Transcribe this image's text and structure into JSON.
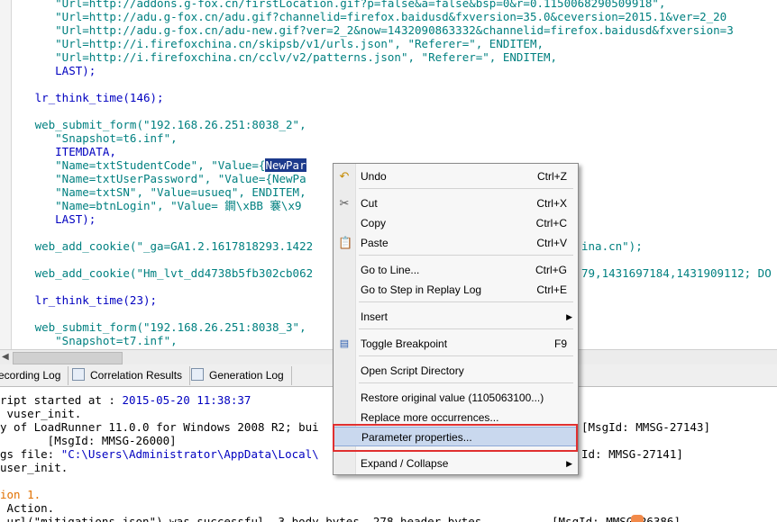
{
  "editor": {
    "lines": [
      {
        "kind": "raw",
        "text": "      \"Url=http://addons.g-fox.cn/firstLocation.gif?p=false&a=false&bsp=0&r=0.1150068290509918\","
      },
      {
        "kind": "raw",
        "text": "      \"Url=http://adu.g-fox.cn/adu.gif?channelid=firefox.baidusd&fxversion=35.0&ceversion=2015.1&ver=2_20"
      },
      {
        "kind": "raw",
        "text": "      \"Url=http://adu.g-fox.cn/adu-new.gif?ver=2_2&now=1432090863332&channelid=firefox.baidusd&fxversion=3"
      },
      {
        "kind": "raw",
        "text": "      \"Url=http://i.firefoxchina.cn/skipsb/v1/urls.json\", \"Referer=\", ENDITEM,"
      },
      {
        "kind": "raw",
        "text": "      \"Url=http://i.firefoxchina.cn/cclv/v2/patterns.json\", \"Referer=\", ENDITEM,"
      },
      {
        "kind": "raw",
        "text": "      LAST);"
      },
      {
        "kind": "raw",
        "text": ""
      },
      {
        "kind": "raw",
        "text": "   lr_think_time(146);"
      },
      {
        "kind": "raw",
        "text": ""
      },
      {
        "kind": "raw",
        "text": "   web_submit_form(\"192.168.26.251:8038_2\","
      },
      {
        "kind": "raw",
        "text": "      \"Snapshot=t6.inf\","
      },
      {
        "kind": "raw",
        "text": "      ITEMDATA,"
      },
      {
        "kind": "sel",
        "before": "      \"Name=txtStudentCode\", \"Value={",
        "selected": "NewPar",
        "after": ""
      },
      {
        "kind": "raw",
        "text": "      \"Name=txtUserPassword\", \"Value={NewPa"
      },
      {
        "kind": "raw",
        "text": "      \"Name=txtSN\", \"Value=usueq\", ENDITEM,"
      },
      {
        "kind": "raw",
        "text": "      \"Name=btnLogin\", \"Value= 鐧\\xBB 褰\\x9"
      },
      {
        "kind": "raw",
        "text": "      LAST);"
      },
      {
        "kind": "raw",
        "text": ""
      },
      {
        "kind": "raw",
        "text": "   web_add_cookie(\"_ga=GA1.2.1617818293.1422"
      },
      {
        "kind": "raw",
        "text": ""
      },
      {
        "kind": "raw",
        "text": "   web_add_cookie(\"Hm_lvt_dd4738b5fb302cb062"
      },
      {
        "kind": "raw",
        "text": ""
      },
      {
        "kind": "raw",
        "text": "   lr_think_time(23);"
      },
      {
        "kind": "raw",
        "text": ""
      },
      {
        "kind": "raw",
        "text": "   web_submit_form(\"192.168.26.251:8038_3\","
      },
      {
        "kind": "raw",
        "text": "      \"Snapshot=t7.inf\","
      }
    ],
    "right_fragments": {
      "line18": "ina.cn\");",
      "line20": "79,1431697184,1431909112; DO"
    }
  },
  "tabs": [
    {
      "label": "ecording Log",
      "icon": "log-icon"
    },
    {
      "label": "Correlation Results",
      "icon": "correlation-icon"
    },
    {
      "label": "Generation Log",
      "icon": "generation-log-icon"
    }
  ],
  "output": {
    "lines": [
      {
        "text": "ript started at : ",
        "highlight": "2015-05-20 11:38:37",
        "rest": ""
      },
      {
        "text": " vuser_init.",
        "highlight": "",
        "rest": ""
      },
      {
        "text": "y of LoadRunner 11.0.0 for Windows 2008 R2; bui",
        "highlight": "",
        "rest": ""
      },
      {
        "text": "       [MsgId: MMSG-26000]",
        "highlight": "",
        "rest": ""
      },
      {
        "text": "gs file: ",
        "highlight": "\"C:\\Users\\Administrator\\AppData\\Local\\",
        "rest": ""
      },
      {
        "text": "user_init.",
        "highlight": "",
        "rest": ""
      },
      {
        "text": "",
        "highlight": "",
        "rest": ""
      },
      {
        "text": "",
        "orange": "ion 1.",
        "rest": ""
      },
      {
        "text": " Action.",
        "highlight": "",
        "rest": ""
      },
      {
        "text": " url(\"mitigations.json\") was successful, 3 body bytes, 278 header bytes",
        "highlight": "",
        "rest": ""
      }
    ],
    "right_fragments": {
      "msg1": "[MsgId: MMSG-27143]",
      "msg2": "Id: MMSG-27141]",
      "msg3": "[MsgId: MMSG-26386]"
    }
  },
  "context_menu": {
    "items": [
      {
        "label": "Undo",
        "shortcut": "Ctrl+Z",
        "icon": "undo-icon"
      },
      {
        "label": "Cut",
        "shortcut": "Ctrl+X",
        "icon": "cut-icon"
      },
      {
        "label": "Copy",
        "shortcut": "Ctrl+C",
        "icon": ""
      },
      {
        "label": "Paste",
        "shortcut": "Ctrl+V",
        "icon": "paste-icon"
      },
      {
        "label": "Go to Line...",
        "shortcut": "Ctrl+G",
        "icon": ""
      },
      {
        "label": "Go to Step in Replay Log",
        "shortcut": "Ctrl+E",
        "icon": ""
      },
      {
        "label": "Insert",
        "shortcut": "",
        "icon": "",
        "submenu": "▶"
      },
      {
        "label": "Toggle Breakpoint",
        "shortcut": "F9",
        "icon": "breakpoint-icon"
      },
      {
        "label": "Open Script Directory",
        "shortcut": "",
        "icon": ""
      },
      {
        "label": "Restore original value (1105063100...)",
        "shortcut": "",
        "icon": ""
      },
      {
        "label": "Replace more occurrences...",
        "shortcut": "",
        "icon": ""
      },
      {
        "label": "Parameter properties...",
        "shortcut": "",
        "icon": ""
      },
      {
        "label": "Expand / Collapse",
        "shortcut": "",
        "icon": "",
        "submenu": "▶"
      }
    ]
  },
  "colors": {
    "highlight_box": "#e03030",
    "selection": "#1c3a8c",
    "code_string": "#008080",
    "code_keyword": "#0000c0"
  }
}
